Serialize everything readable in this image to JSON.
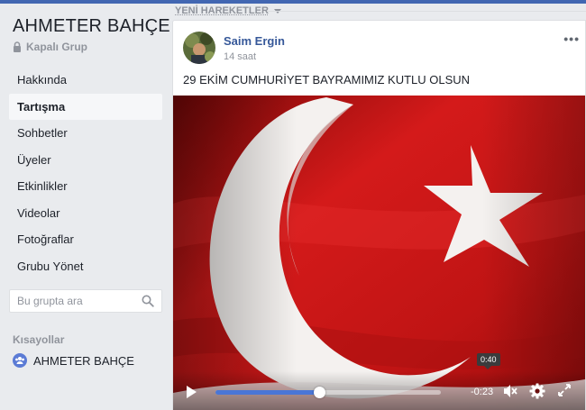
{
  "group": {
    "name": "AHMETER BAHÇE",
    "privacy": "Kapalı Grup"
  },
  "nav": {
    "items": [
      {
        "label": "Hakkında",
        "active": false
      },
      {
        "label": "Tartışma",
        "active": true
      },
      {
        "label": "Sohbetler",
        "active": false
      },
      {
        "label": "Üyeler",
        "active": false
      },
      {
        "label": "Etkinlikler",
        "active": false
      },
      {
        "label": "Videolar",
        "active": false
      },
      {
        "label": "Fotoğraflar",
        "active": false
      },
      {
        "label": "Grubu Yönet",
        "active": false
      }
    ]
  },
  "search": {
    "placeholder": "Bu grupta ara",
    "value": ""
  },
  "shortcuts": {
    "heading": "Kısayollar",
    "items": [
      {
        "label": "AHMETER BAHÇE",
        "icon": "group-icon"
      }
    ]
  },
  "feed": {
    "sort_label": "YENİ HAREKETLER"
  },
  "post": {
    "author": "Saim Ergin",
    "time": "14 saat",
    "text": "29 EKİM CUMHURİYET BAYRAMIMIZ KUTLU OLSUN",
    "more": "•••"
  },
  "video": {
    "progress": 0.46,
    "time_remaining": "-0:23",
    "hover_time": "0:40",
    "colors": {
      "flag_red": "#d41a1a",
      "flag_white": "#ffffff",
      "progress": "#4a76d6"
    }
  },
  "colors": {
    "brand": "#4267b2",
    "link": "#365899",
    "page_bg": "#e9ebee"
  }
}
